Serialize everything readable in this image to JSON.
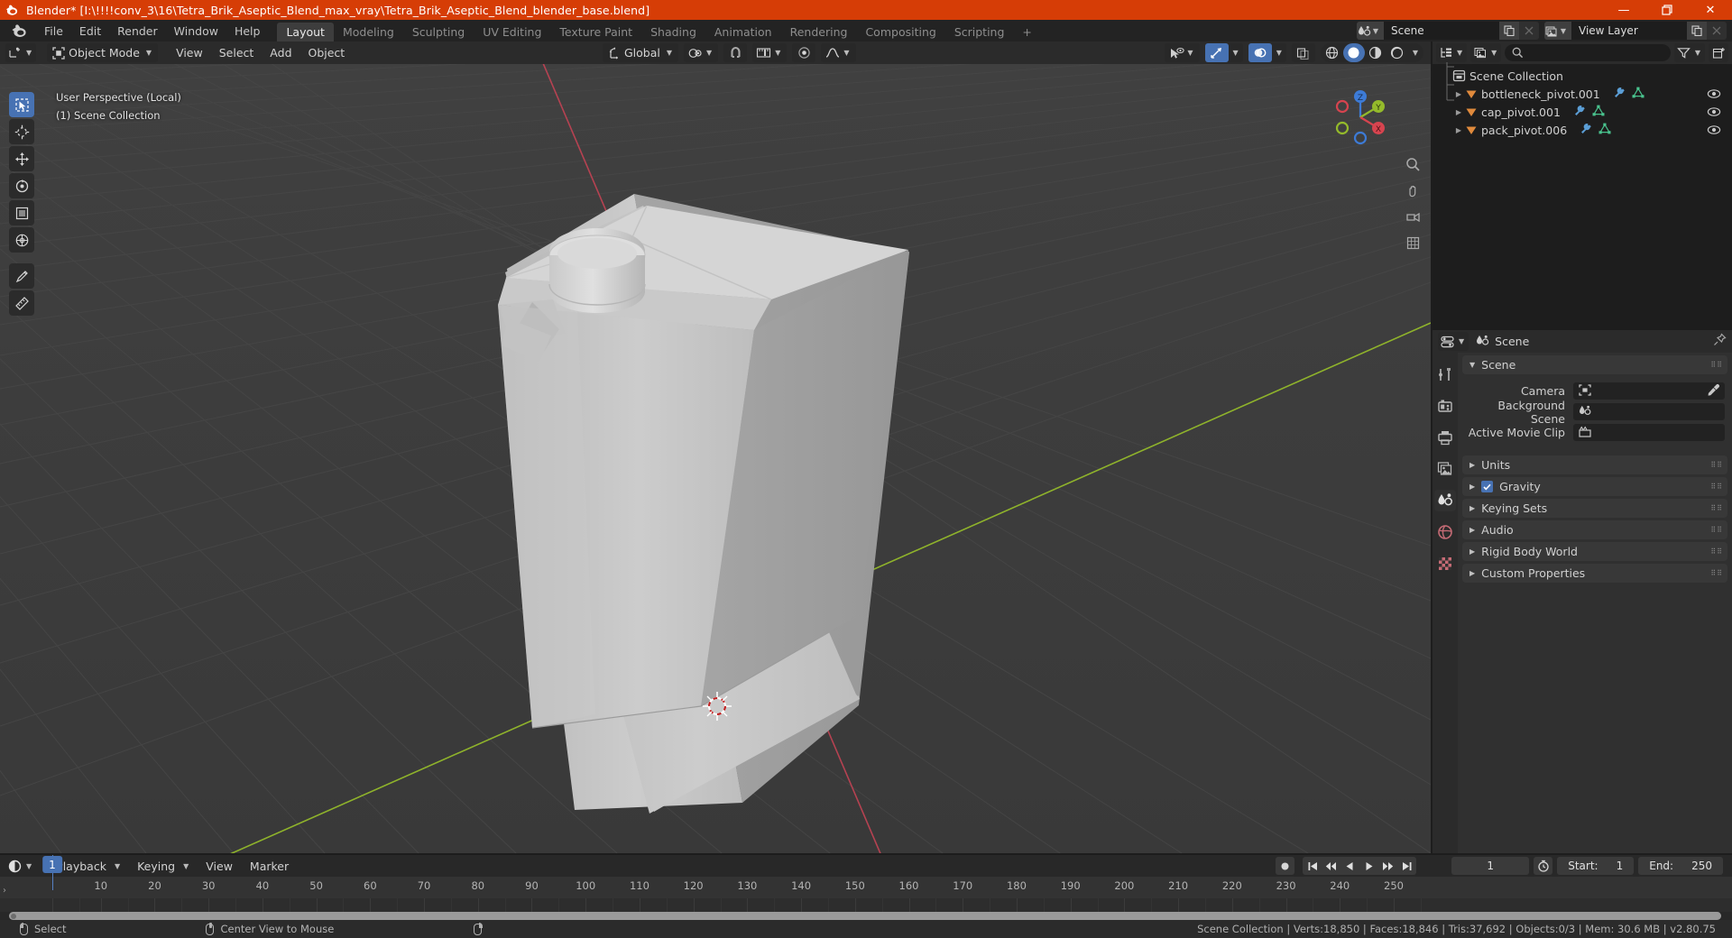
{
  "window": {
    "title": "Blender* [I:\\!!!!conv_3\\16\\Tetra_Brik_Aseptic_Blend_max_vray\\Tetra_Brik_Aseptic_Blend_blender_base.blend]",
    "minimize": "—",
    "restore": "❐",
    "close": "✕"
  },
  "menus": [
    "File",
    "Edit",
    "Render",
    "Window",
    "Help"
  ],
  "workspaces": {
    "tabs": [
      "Layout",
      "Modeling",
      "Sculpting",
      "UV Editing",
      "Texture Paint",
      "Shading",
      "Animation",
      "Rendering",
      "Compositing",
      "Scripting"
    ],
    "active": "Layout",
    "add": "+"
  },
  "topright": {
    "scene": {
      "name": "Scene",
      "new_icon": "copy-icon",
      "unlink_icon": "x-icon"
    },
    "view_layer": {
      "name": "View Layer",
      "new_icon": "copy-icon",
      "unlink_icon": "x-icon"
    }
  },
  "viewport": {
    "mode": "Object Mode",
    "menus": [
      "View",
      "Select",
      "Add",
      "Object"
    ],
    "orientation": "Global",
    "overlay_text_line1": "User Perspective (Local)",
    "overlay_text_line2": "(1) Scene Collection",
    "gizmo_axes": [
      "X",
      "Y",
      "Z"
    ],
    "shading_modes": [
      "wireframe",
      "solid",
      "material-preview",
      "rendered"
    ],
    "shading_active": "solid"
  },
  "outliner": {
    "search_placeholder": "",
    "root": "Scene Collection",
    "items": [
      {
        "name": "bottleneck_pivot.001",
        "indent": 0
      },
      {
        "name": "cap_pivot.001",
        "indent": 0
      },
      {
        "name": "pack_pivot.006",
        "indent": 0
      }
    ]
  },
  "properties": {
    "breadcrumb": "Scene",
    "tabs": [
      "tool",
      "render",
      "output",
      "view-layer",
      "scene",
      "world",
      "texture"
    ],
    "active_tab": "scene",
    "scene_panel_title": "Scene",
    "rows": [
      {
        "label": "Camera",
        "value": "",
        "icon": "camera-data-icon",
        "eyedropper": true
      },
      {
        "label": "Background Scene",
        "value": "",
        "icon": "scene-icon",
        "eyedropper": false
      },
      {
        "label": "Active Movie Clip",
        "value": "",
        "icon": "clip-icon",
        "eyedropper": false
      }
    ],
    "sections": [
      {
        "label": "Units",
        "checkbox": false
      },
      {
        "label": "Gravity",
        "checkbox": true,
        "checked": true
      },
      {
        "label": "Keying Sets",
        "checkbox": false
      },
      {
        "label": "Audio",
        "checkbox": false
      },
      {
        "label": "Rigid Body World",
        "checkbox": false
      },
      {
        "label": "Custom Properties",
        "checkbox": false
      }
    ]
  },
  "timeline": {
    "menus": [
      "Playback",
      "Keying",
      "View",
      "Marker"
    ],
    "current_frame": "1",
    "start_label": "Start:",
    "start_value": "1",
    "end_label": "End:",
    "end_value": "250",
    "ticks": [
      1,
      10,
      20,
      30,
      40,
      50,
      60,
      70,
      80,
      90,
      100,
      110,
      120,
      130,
      140,
      150,
      160,
      170,
      180,
      190,
      200,
      210,
      220,
      230,
      240,
      250
    ],
    "playhead_frame": 1
  },
  "statusbar": {
    "hints": [
      {
        "icon": "mouse-left-icon",
        "label": "Select"
      },
      {
        "icon": "mouse-middle-icon",
        "label": "Center View to Mouse"
      },
      {
        "icon": "mouse-right-icon",
        "label": ""
      }
    ],
    "info": "Scene Collection | Verts:18,850 | Faces:18,846 | Tris:37,692 | Objects:0/3 | Mem: 30.6 MB | v2.80.75"
  },
  "colors": {
    "accent_orange": "#d63d06",
    "accent_blue": "#4772b3",
    "viewport_bg": "#3d3d3d",
    "grid_line": "#474747",
    "axis_x": "#bc4353",
    "axis_y": "#94ba2b",
    "object_grey": "#c8c8c8"
  }
}
